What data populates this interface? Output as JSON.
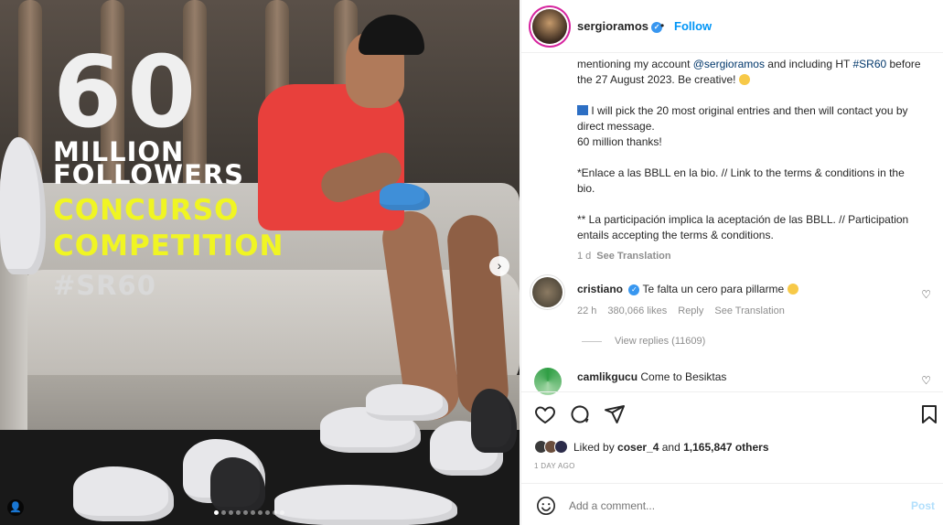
{
  "media": {
    "overlay": {
      "big_number": "60",
      "line_million": "MILLION",
      "line_followers": "FOLLOWERS",
      "line_concurso": "CONCURSO",
      "line_competition": "COMPETITION",
      "line_hashtag": "#SR60"
    },
    "carousel_total": 10,
    "carousel_active_index": 0
  },
  "header": {
    "username": "sergioramos",
    "separator": "•",
    "follow_label": "Follow"
  },
  "caption": {
    "p1_text_a": "mentioning my account ",
    "p1_mention": "@sergioramos",
    "p1_text_b": " and including HT ",
    "p1_hashtag": "#SR60",
    "p1_text_c": " before the 27 August 2023. Be creative! ",
    "p2_text": " I will pick the 20 most original entries and then will contact you by direct message.",
    "p2_text_b": "60 million thanks!",
    "p3_text": "*Enlace a las BBLL en la bio. // Link to the terms & conditions in the bio.",
    "p4_text": "** La participación implica la aceptación de las BBLL. // Participation entails accepting the terms & conditions.",
    "age": "1 d",
    "see_translation": "See Translation"
  },
  "comments": [
    {
      "username": "cristiano",
      "text": "Te falta un cero para pillarme",
      "age": "22 h",
      "likes": "380,066 likes",
      "reply": "Reply",
      "see_translation": "See Translation"
    },
    {
      "username": "camlikgucu",
      "text": "Come to Besiktas"
    }
  ],
  "view_replies": "View replies (11609)",
  "likes": {
    "prefix": "Liked by ",
    "user": "coser_4",
    "middle": " and ",
    "count": "1,165,847 others"
  },
  "timestamp": "1 DAY AGO",
  "add_comment": {
    "placeholder": "Add a comment...",
    "post_label": "Post"
  },
  "colors": {
    "accent_blue": "#0095f6",
    "overlay_yellow": "#f0f523"
  }
}
